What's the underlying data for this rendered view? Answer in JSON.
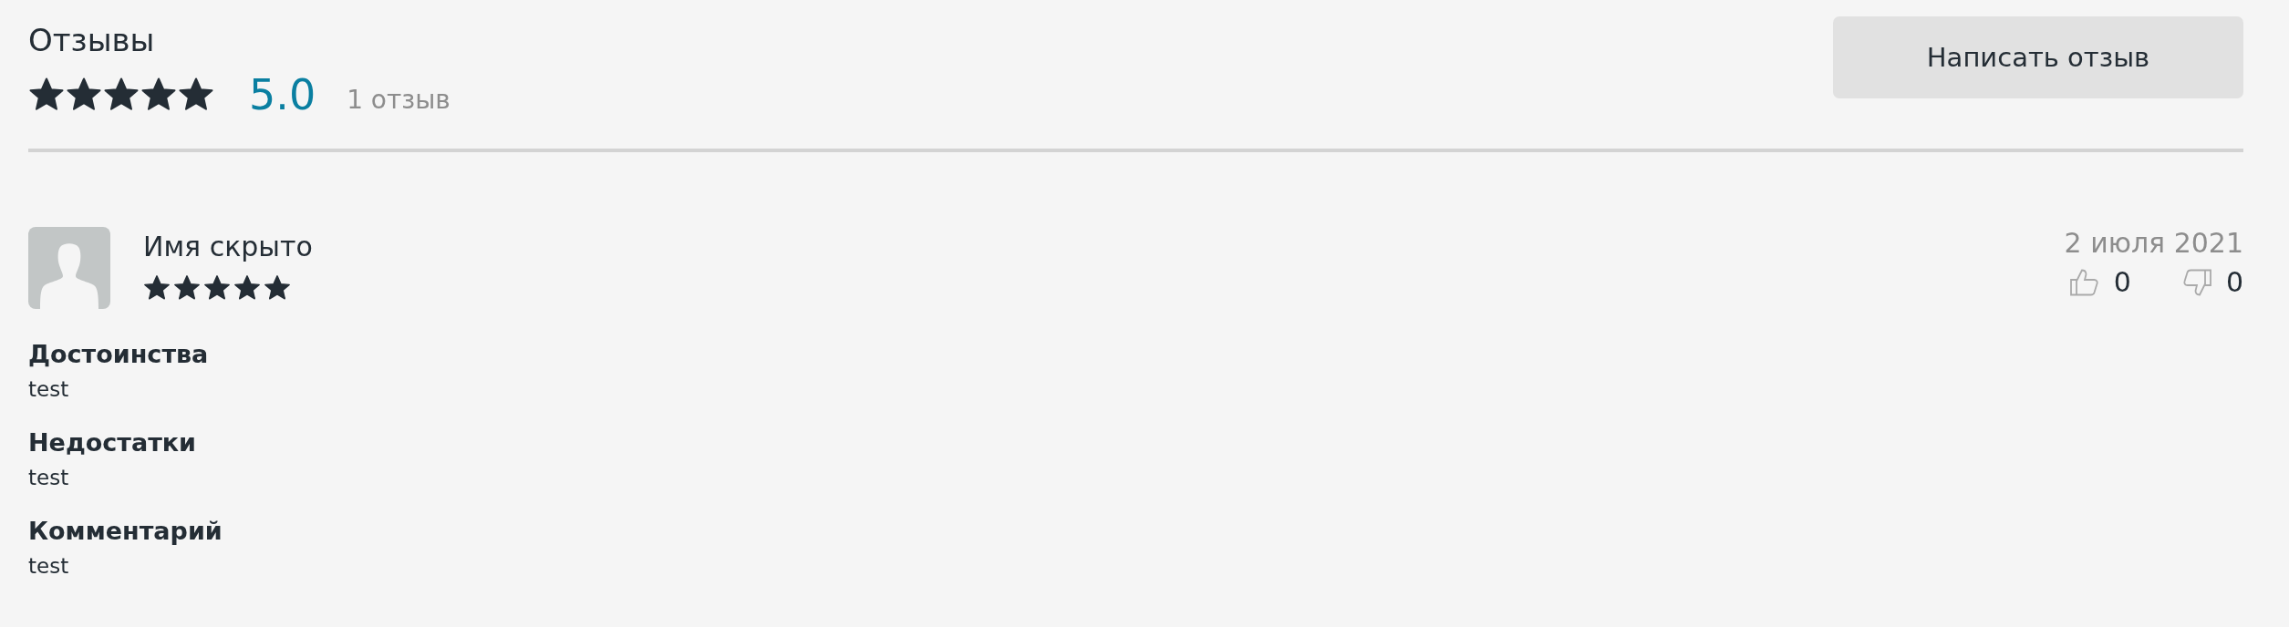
{
  "header": {
    "title": "Отзывы",
    "stars": 5,
    "rating": "5.0",
    "count": "1 отзыв",
    "button": "Написать отзыв"
  },
  "reviews": [
    {
      "author": "Имя скрыто",
      "stars": 5,
      "date": "2 июля 2021",
      "likes": "0",
      "dislikes": "0",
      "sections": [
        {
          "heading": "Достоинства",
          "text": "test"
        },
        {
          "heading": "Недостатки",
          "text": "test"
        },
        {
          "heading": "Комментарий",
          "text": "test"
        }
      ]
    }
  ]
}
